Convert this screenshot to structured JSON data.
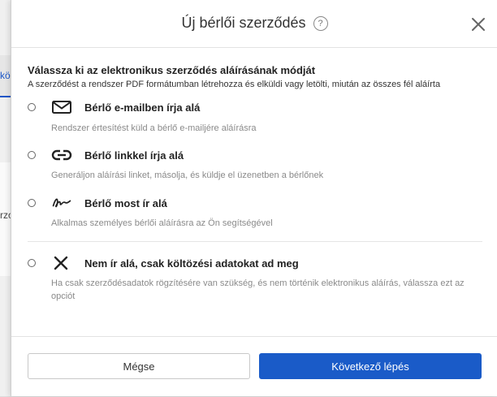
{
  "background": {
    "tab_label": "kö",
    "label": "rzo"
  },
  "modal": {
    "title": "Új bérlői szerződés",
    "help_icon": "question-circle-icon",
    "close_icon": "close-icon",
    "section_heading": "Válassza ki az elektronikus szerződés aláírásának módját",
    "section_subtext": "A szerződést a rendszer PDF formátumban létrehozza és elküldi vagy letölti, miután az összes fél aláírta",
    "options": [
      {
        "icon": "envelope-icon",
        "title": "Bérlő e-mailben írja alá",
        "desc": "Rendszer értesítést küld a bérlő e-mailjére aláírásra"
      },
      {
        "icon": "link-icon",
        "title": "Bérlő linkkel írja alá",
        "desc": "Generáljon aláírási linket, másolja, és küldje el üzenetben a bérlőnek"
      },
      {
        "icon": "signature-icon",
        "title": "Bérlő most ír alá",
        "desc": "Alkalmas személyes bérlői aláírásra az Ön segítségével"
      },
      {
        "icon": "x-icon",
        "title": "Nem ír alá, csak költözési adatokat ad meg",
        "desc": "Ha csak szerződésadatok rögzítésére van szükség, és nem történik elektronikus aláírás, válassza ezt az opciót"
      }
    ],
    "cancel_label": "Mégse",
    "next_label": "Következő lépés",
    "accent_color": "#1a5bc8"
  }
}
